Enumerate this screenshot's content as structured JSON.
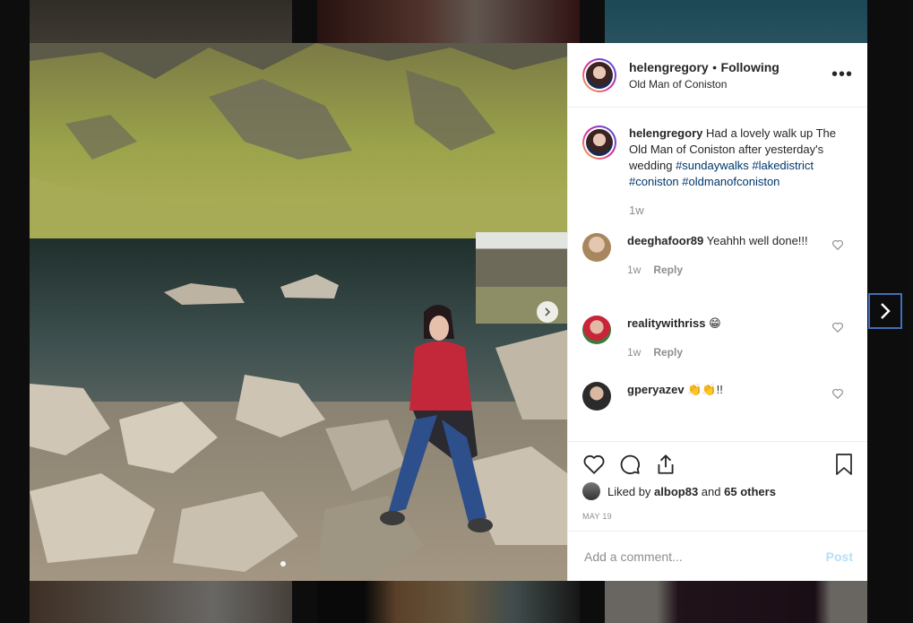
{
  "post": {
    "header": {
      "username": "helengregory",
      "separator": "•",
      "follow_status": "Following",
      "location": "Old Man of Coniston",
      "more_icon": "more-horizontal-icon"
    },
    "caption": {
      "username": "helengregory",
      "text": "Had a lovely walk up The Old Man of Coniston after yesterday's wedding",
      "hashtags": [
        "#sundaywalks",
        "#lakedistrict",
        "#coniston",
        "#oldmanofconiston"
      ],
      "time": "1w"
    },
    "comments": [
      {
        "username": "deeghafoor89",
        "text": "Yeahhh well done!!!",
        "time": "1w",
        "reply_label": "Reply"
      },
      {
        "username": "realitywithriss",
        "text": "😁",
        "time": "1w",
        "reply_label": "Reply"
      },
      {
        "username": "gperyazev",
        "text": "👏👏!!",
        "time": "",
        "reply_label": ""
      }
    ],
    "likes": {
      "prefix": "Liked by",
      "user": "albop83",
      "conjunction": "and",
      "others": "65 others"
    },
    "date": "MAY 19",
    "add_comment": {
      "placeholder": "Add a comment...",
      "post_label": "Post"
    }
  },
  "colors": {
    "hashtag": "#00376b",
    "post_button_disabled": "#b2dffc",
    "next_arrow_border": "#3f6fb8",
    "meta_text": "#8e8e8e"
  },
  "icons": [
    "heart-icon",
    "comment-icon",
    "share-icon",
    "bookmark-icon",
    "chevron-right-icon"
  ]
}
